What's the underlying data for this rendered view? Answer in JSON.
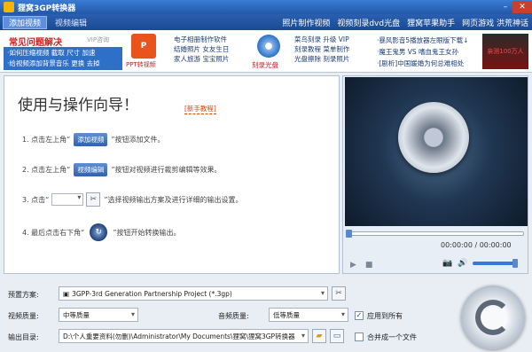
{
  "window": {
    "title": "狸窝3GP转换器"
  },
  "menubar": {
    "tabs": [
      "添加视频",
      "视频编辑"
    ],
    "links": [
      "照片制作视频",
      "视频刻录dvd光盘",
      "狸窝苹果助手",
      "网页游戏 洪荒神话"
    ]
  },
  "adbar": {
    "faq_title": "常见问题解决",
    "vip_label": "VIP咨询",
    "faq_items": [
      "·如何压缩视频 截取 尺寸 加速",
      "·给视频添加背景音乐 更换 去掉"
    ],
    "ppt_label": "PPT转视频",
    "col1": [
      "电子相册制作软件",
      "结婚照片 女友生日",
      "家人旅游 宝宝照片"
    ],
    "disc_label": "刻录光盘",
    "col2": [
      "菜鸟刻录 升级 VIP",
      "刻录教程 菜单制作",
      "光盘擦除 刻录照片"
    ],
    "right": [
      "·暴风影音5播放器左眼版下载↓",
      "·魔王鬼男 VS 嗜血鬼王女孙",
      "·[剧析]中国媛婚为何总难相处"
    ],
    "promo": "亲测100万人"
  },
  "guide": {
    "title": "使用与操作向导！",
    "tutorial_link": "[新手教程]",
    "step1_pre": "1. 点击左上角“",
    "step1_btn": "添加视频",
    "step1_post": "”按钮添加文件。",
    "step2_pre": "2. 点击左上角“",
    "step2_btn": "视频编辑",
    "step2_post": "”按钮对视频进行裁剪编辑等效果。",
    "step3_pre": "3. 点击“",
    "step3_post": "”选择视频输出方案及进行详细的输出设置。",
    "step4_pre": "4. 最后点击右下角“",
    "step4_post": "”按钮开始转换输出。"
  },
  "player": {
    "timecode": "00:00:00 / 00:00:00",
    "volume": 0.85
  },
  "bottom": {
    "preset_label": "预置方案:",
    "preset_value": "3GPP-3rd Generation Partnership Project (*.3gp)",
    "video_quality_label": "视频质量:",
    "video_quality_value": "中等质量",
    "audio_quality_label": "音频质量:",
    "audio_quality_value": "低等质量",
    "apply_all_label": "应用到所有",
    "output_label": "输出目录:",
    "output_value": "D:\\个人重要资料(勿删)\\Administrator\\My Documents\\狸窝\\狸窝3GP转换器",
    "merge_label": "合并成一个文件"
  },
  "colors": {
    "accent": "#2159a8",
    "link": "#e04000"
  }
}
